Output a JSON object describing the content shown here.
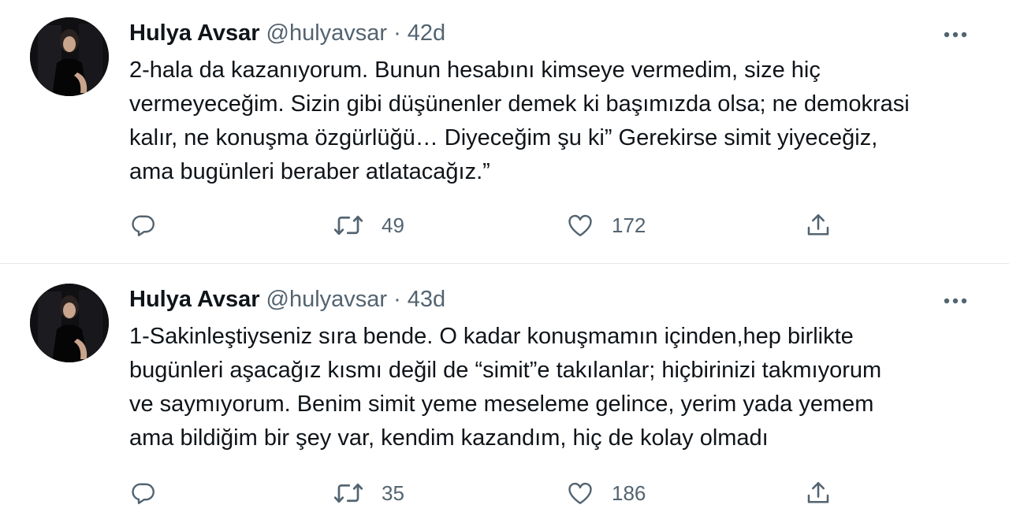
{
  "tweets": [
    {
      "author": {
        "name": "Hulya Avsar",
        "handle": "@hulyavsar"
      },
      "separator": "·",
      "time": "42d",
      "lines": [
        "2-hala da kazanıyorum. Bunun hesabını kimseye vermedim, size hiç",
        "vermeyeceğim. Sizin gibi düşünenler demek ki başımızda olsa; ne demokrasi",
        "kalır, ne konuşma özgürlüğü… Diyeceğim şu ki” Gerekirse simit yiyeceğiz,",
        "ama bugünleri beraber atlatacağız.”"
      ],
      "stats": {
        "retweets": "49",
        "likes": "172"
      }
    },
    {
      "author": {
        "name": "Hulya Avsar",
        "handle": "@hulyavsar"
      },
      "separator": "·",
      "time": "43d",
      "lines": [
        "1-Sakinleştiyseniz sıra bende. O kadar konuşmamın içinden,hep birlikte",
        "bugünleri aşacağız kısmı değil de “simit”e takılanlar; hiçbirinizi takmıyorum",
        "ve saymıyorum. Benim simit yeme meseleme gelince, yerim yada yemem",
        "ama bildiğim bir şey var, kendim kazandım, hiç de kolay olmadı"
      ],
      "stats": {
        "retweets": "35",
        "likes": "186"
      }
    }
  ],
  "icons": {
    "reply": "reply-icon",
    "retweet": "retweet-icon",
    "like": "heart-icon",
    "share": "share-icon",
    "more": "more-options-icon"
  },
  "colors": {
    "text": "#0f1419",
    "secondary": "#536471",
    "divider": "#e4e8ec"
  }
}
